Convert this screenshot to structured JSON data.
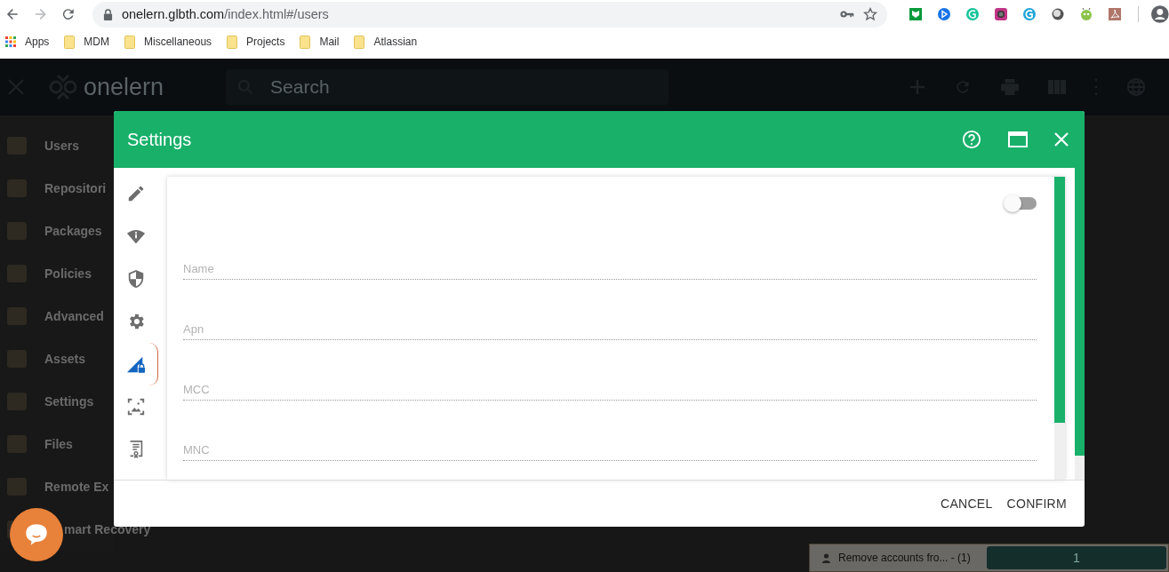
{
  "browser": {
    "url_host": "onelern.glbth.com",
    "url_path": "/index.html#/users",
    "bookmarks": [
      {
        "label": "Apps",
        "kind": "apps"
      },
      {
        "label": "MDM",
        "kind": "folder"
      },
      {
        "label": "Miscellaneous",
        "kind": "folder"
      },
      {
        "label": "Projects",
        "kind": "folder"
      },
      {
        "label": "Mail",
        "kind": "folder"
      },
      {
        "label": "Atlassian",
        "kind": "folder"
      }
    ]
  },
  "app": {
    "logo": "onelern",
    "search": {
      "placeholder": "Search"
    },
    "sidebar": {
      "items": [
        {
          "label": "Users"
        },
        {
          "label": "Repositori"
        },
        {
          "label": "Packages"
        },
        {
          "label": "Policies"
        },
        {
          "label": "Advanced"
        },
        {
          "label": "Assets"
        },
        {
          "label": "Settings"
        },
        {
          "label": "Files"
        },
        {
          "label": "Remote Ex"
        },
        {
          "label": "mart Recovery"
        }
      ]
    },
    "task": {
      "label": "Remove accounts fro... - (1)",
      "count": "1",
      "level": 1
    }
  },
  "dialog": {
    "title": "Settings",
    "tabs": [
      {
        "selected": false
      },
      {
        "selected": false
      },
      {
        "selected": false
      },
      {
        "selected": false
      },
      {
        "selected": true
      },
      {
        "selected": false
      },
      {
        "selected": false
      }
    ],
    "toggle": {
      "on": false
    },
    "fields": [
      {
        "placeholder": "Name"
      },
      {
        "placeholder": "Apn"
      },
      {
        "placeholder": "MCC"
      },
      {
        "placeholder": "MNC"
      }
    ],
    "buttons": [
      "CANCEL",
      "CONFIRM"
    ]
  }
}
